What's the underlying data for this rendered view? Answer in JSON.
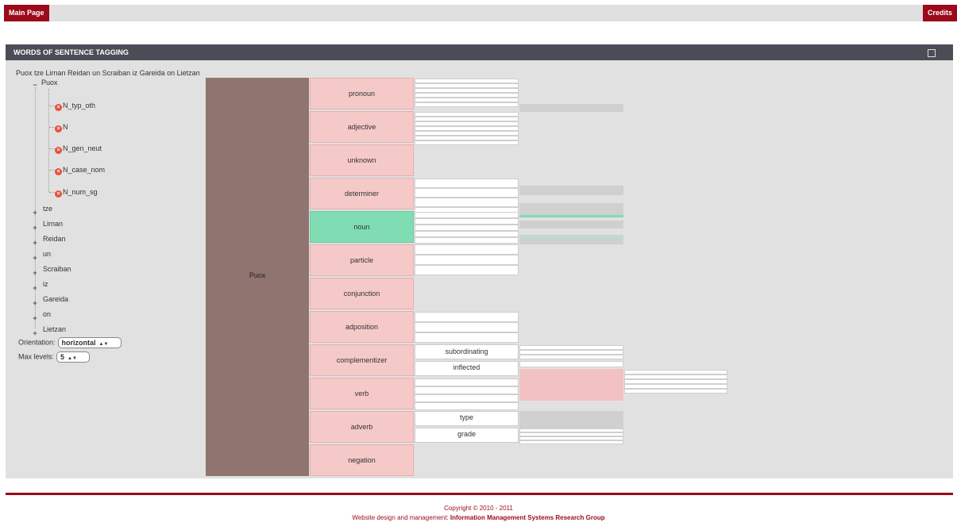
{
  "nav": {
    "main_page": "Main Page",
    "credits": "Credits"
  },
  "panel": {
    "title": "WORDS OF SENTENCE TAGGING"
  },
  "sentence": "Puox tze Lirnan Reidan un Scraiban iz Gareida on Lietzan",
  "tree": {
    "expanded_word": "Puox",
    "tags": [
      "N_typ_oth",
      "N",
      "N_gen_neut",
      "N_case_nom",
      "N_num_sg"
    ],
    "collapsed_words": [
      "tze",
      "Lirnan",
      "Reidan",
      "un",
      "Scraiban",
      "iz",
      "Gareida",
      "on",
      "Lietzan"
    ]
  },
  "controls": {
    "orientation_label": "Orientation:",
    "orientation_value": "horizontal",
    "max_levels_label": "Max levels:",
    "max_levels_value": "5"
  },
  "graph": {
    "root": "Puox",
    "pos": [
      "pronoun",
      "adjective",
      "unknown",
      "determiner",
      "noun",
      "particle",
      "conjunction",
      "adposition",
      "complementizer",
      "verb",
      "adverb",
      "negation"
    ],
    "selected_pos": "noun",
    "complementizer_subs": [
      "subordinating",
      "inflected"
    ],
    "adverb_subs": [
      "type",
      "grade"
    ]
  },
  "footer": {
    "copyright": "Copyright © 2010 - 2011",
    "design_prefix": "Website design and management:",
    "design_group": "Information Management Systems Research Group"
  },
  "colors": {
    "brand": "#9b0a1a",
    "pos_fill": "#f6c9c9",
    "selected_fill": "#7fdcb3",
    "root_fill": "#8f7470"
  }
}
